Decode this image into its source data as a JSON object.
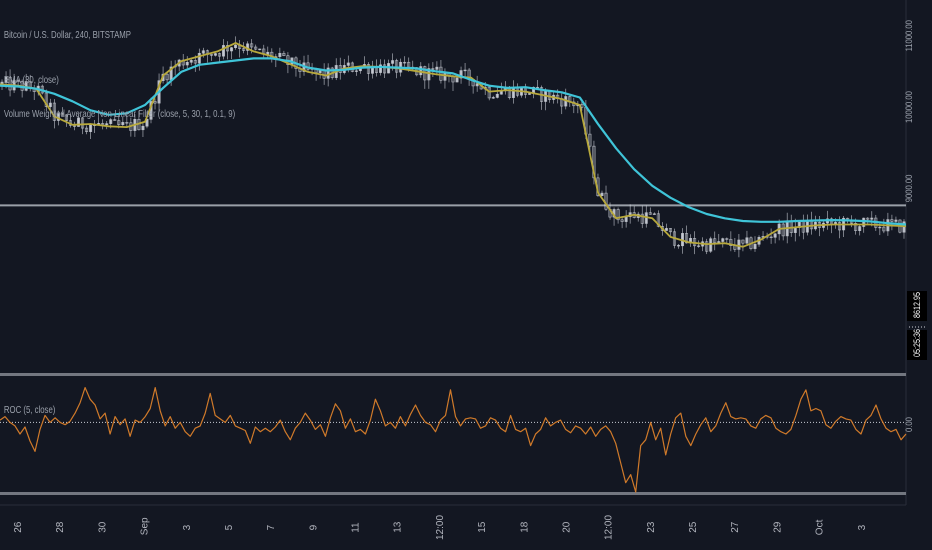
{
  "main_pane": {
    "title": "Bitcoin / U.S. Dollar, 240, BITSTAMP",
    "legend": [
      "EMA (30, close)",
      "Volume Weighted Average Non-Linear Filter (close, 5, 30, 1, 0.1, 9)"
    ]
  },
  "osc_pane": {
    "title": "ROC (5, close)",
    "zero_label": "0.00"
  },
  "badges": [
    "8612.95",
    "05:25:36"
  ],
  "colors": {
    "background": "#131722",
    "candle": "#d8dce4",
    "ema": "#3fc4d8",
    "filter": "#b8a93c",
    "roc": "#d07a2a",
    "hline": "#9aa0a8",
    "separator": "#737780"
  },
  "chart_data": [
    {
      "type": "line",
      "title": "Bitcoin / U.S. Dollar, 240, BITSTAMP",
      "y_scale": "log",
      "ylim": [
        7000,
        11500
      ],
      "x_ticks": [
        "26",
        "28",
        "30",
        "Sep",
        "3",
        "5",
        "7",
        "9",
        "11",
        "13",
        "12:00",
        "15",
        "18",
        "20",
        "12:00",
        "23",
        "25",
        "27",
        "29",
        "Oct",
        "3"
      ],
      "y_ticks": [
        {
          "label": "11000.00",
          "value": 11000
        },
        {
          "label": "10000.00",
          "value": 10000
        },
        {
          "label": "9000.00",
          "value": 9000
        }
      ],
      "horizontal_line": 8750,
      "x": [
        0,
        2,
        4,
        6,
        8,
        10,
        12,
        14,
        16,
        18,
        20,
        22,
        24,
        26,
        28,
        30,
        32,
        34,
        36,
        38,
        40,
        42,
        44,
        46,
        48,
        50,
        52,
        54,
        56,
        58,
        60,
        62,
        64,
        66,
        68,
        70,
        72,
        74,
        76,
        78,
        80,
        82,
        84,
        86,
        88,
        90,
        92,
        94,
        96,
        98,
        100
      ],
      "series": [
        {
          "name": "EMA (30, close)",
          "values": [
            10260,
            10250,
            10220,
            10150,
            10050,
            9930,
            9870,
            9890,
            10000,
            10230,
            10450,
            10550,
            10580,
            10610,
            10640,
            10640,
            10600,
            10510,
            10470,
            10480,
            10510,
            10520,
            10510,
            10500,
            10460,
            10430,
            10340,
            10260,
            10230,
            10240,
            10200,
            10170,
            10100,
            9750,
            9440,
            9180,
            8980,
            8840,
            8730,
            8650,
            8600,
            8570,
            8560,
            8560,
            8570,
            8575,
            8580,
            8575,
            8565,
            8545,
            8530
          ]
        },
        {
          "name": "Volume Weighted Average Non-Linear Filter",
          "values": [
            10280,
            10260,
            10220,
            9850,
            9740,
            9750,
            9720,
            9710,
            9780,
            10400,
            10600,
            10670,
            10740,
            10860,
            10740,
            10670,
            10560,
            10450,
            10400,
            10500,
            10530,
            10520,
            10500,
            10460,
            10420,
            10390,
            10370,
            10180,
            10200,
            10180,
            10130,
            10080,
            10000,
            8900,
            8600,
            8640,
            8600,
            8390,
            8330,
            8310,
            8320,
            8280,
            8360,
            8480,
            8500,
            8520,
            8530,
            8530,
            8530,
            8520,
            8510
          ]
        }
      ]
    },
    {
      "type": "line",
      "title": "ROC (5, close)",
      "ylim": [
        -6,
        4
      ],
      "zero_line": 0,
      "y_ticks": [
        {
          "label": "0.00",
          "value": 0
        }
      ],
      "series": [
        {
          "name": "ROC (5, close)",
          "values": [
            0.2,
            0.5,
            0,
            -0.3,
            -1,
            -0.4,
            -1.6,
            -2.5,
            -0.6,
            0.6,
            0,
            0.4,
            0,
            -0.2,
            0.1,
            0.8,
            1.7,
            3.0,
            2.0,
            1.5,
            0.3,
            0.8,
            -1.0,
            0.5,
            -0.2,
            0.3,
            -1.2,
            0.2,
            0,
            0.5,
            1.2,
            3.0,
            1.0,
            -0.3,
            0.5,
            -0.5,
            0,
            -0.8,
            -1.2,
            -0.5,
            -0.3,
            0.8,
            2.5,
            0.6,
            0.3,
            0,
            0.6,
            -0.3,
            -0.5,
            -0.7,
            -1.8,
            -0.4,
            -0.8,
            -0.5,
            -0.8,
            -0.4,
            0.2,
            -0.8,
            -1.5,
            -0.5,
            0,
            0.8,
            0.2,
            -0.6,
            -0.2,
            -1.2,
            0.4,
            1.6,
            1.0,
            -0.5,
            0.3,
            -0.8,
            -0.6,
            -1.0,
            0.2,
            2.0,
            1.0,
            -0.3,
            0,
            -0.5,
            0.5,
            -0.3,
            0.7,
            1.5,
            0.6,
            0,
            -0.2,
            -0.8,
            0.2,
            0.6,
            2.8,
            0.5,
            -0.3,
            0.3,
            0.4,
            0.3,
            -0.5,
            -0.3,
            0.4,
            0.2,
            -0.5,
            -0.8,
            0.6,
            -0.6,
            -0.8,
            -0.5,
            -2.0,
            -1.0,
            -0.6,
            0.4,
            -0.3,
            0,
            0.2,
            -0.6,
            -0.9,
            -0.3,
            -0.5,
            -1.0,
            -0.4,
            -1.2,
            -0.6,
            -0.3,
            -0.8,
            -1.8,
            -3.5,
            -5.2,
            -4.5,
            -6.0,
            -2.0,
            -1.5,
            0,
            -1.5,
            -0.5,
            -2.8,
            -1.0,
            0.4,
            0.8,
            -1.2,
            -2.0,
            -1.0,
            -0.2,
            0.4,
            -0.8,
            -0.3,
            0.8,
            1.7,
            0.5,
            0.3,
            0.4,
            0.3,
            -0.3,
            -0.5,
            0.3,
            0.6,
            0.4,
            -0.5,
            -0.8,
            -1.0,
            -0.6,
            0.6,
            2.0,
            2.8,
            1.0,
            1.2,
            1.0,
            -0.2,
            -0.5,
            0.1,
            0.5,
            0.3,
            0.2,
            -0.6,
            -1.0,
            0.2,
            0.6,
            1.5,
            0.3,
            -0.5,
            -0.8,
            -0.6,
            -1.5,
            -1.0
          ]
        }
      ]
    }
  ]
}
